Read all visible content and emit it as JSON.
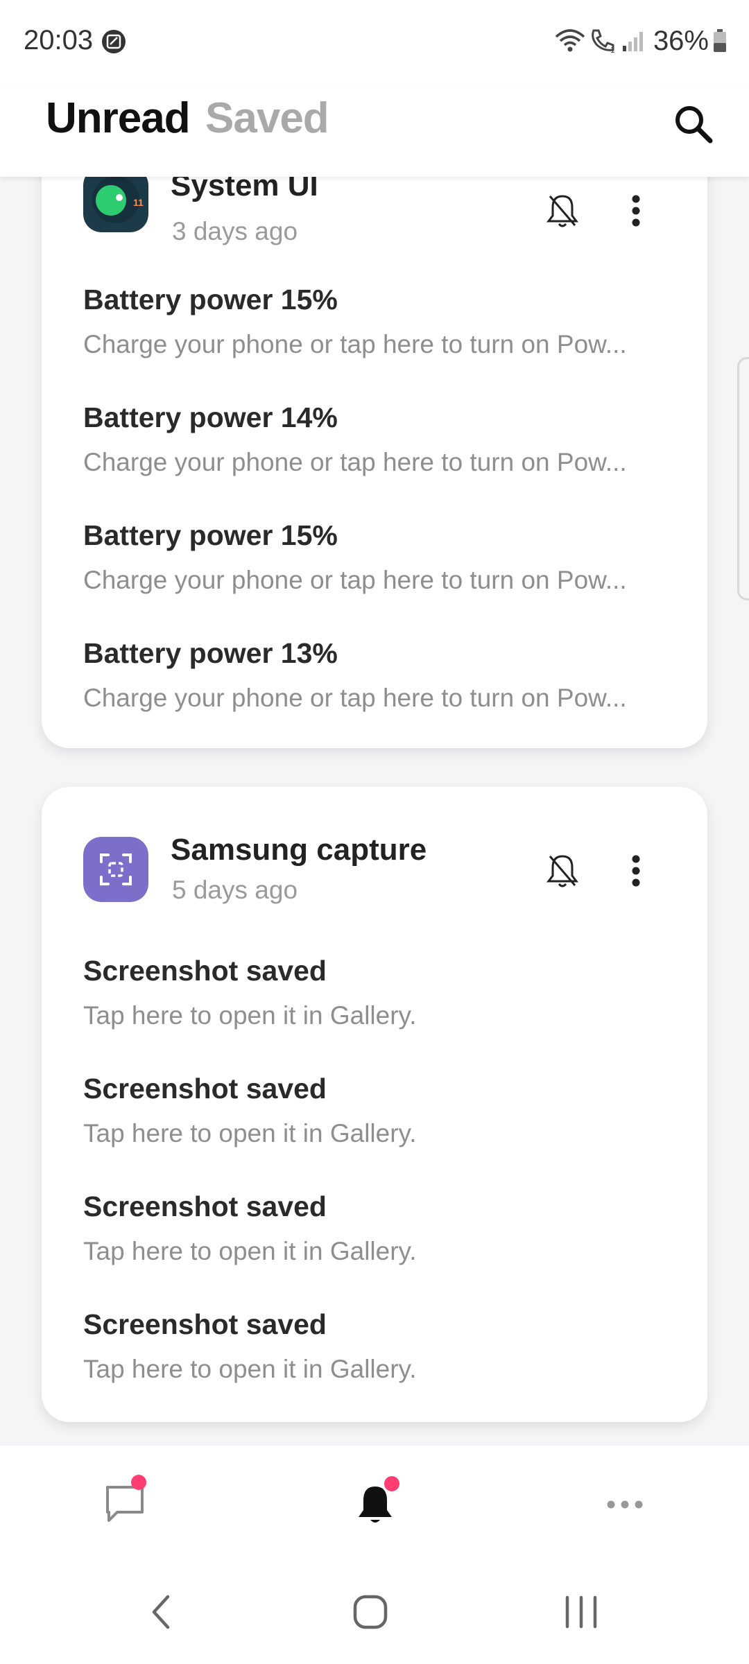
{
  "status_bar": {
    "time": "20:03",
    "battery": "36%",
    "icons": [
      "app-notification-icon",
      "wifi-icon",
      "call-icon",
      "signal-icon",
      "battery-icon"
    ]
  },
  "header": {
    "tabs": [
      {
        "label": "Unread",
        "active": true
      },
      {
        "label": "Saved",
        "active": false
      }
    ],
    "search_icon": "search-icon"
  },
  "cards": [
    {
      "app_name": "System UI",
      "time_ago": "3 days ago",
      "icon": "system-ui-icon",
      "icon_badge": "11",
      "notifications": [
        {
          "title": "Battery power 15%",
          "body": "Charge your phone or tap here to turn on Pow..."
        },
        {
          "title": "Battery power 14%",
          "body": "Charge your phone or tap here to turn on Pow..."
        },
        {
          "title": "Battery power 15%",
          "body": "Charge your phone or tap here to turn on Pow..."
        },
        {
          "title": "Battery power 13%",
          "body": "Charge your phone or tap here to turn on Pow..."
        }
      ]
    },
    {
      "app_name": "Samsung capture",
      "time_ago": "5 days ago",
      "icon": "samsung-capture-icon",
      "notifications": [
        {
          "title": "Screenshot saved",
          "body": "Tap here to open it in Gallery."
        },
        {
          "title": "Screenshot saved",
          "body": "Tap here to open it in Gallery."
        },
        {
          "title": "Screenshot saved",
          "body": "Tap here to open it in Gallery."
        },
        {
          "title": "Screenshot saved",
          "body": "Tap here to open it in Gallery."
        }
      ]
    }
  ],
  "bottom_nav": {
    "items": [
      "chat-icon",
      "bell-icon",
      "more-icon"
    ],
    "badge_color": "#ff3d71"
  },
  "system_nav": [
    "back-icon",
    "home-icon",
    "recents-icon"
  ],
  "colors": {
    "accent_badge": "#ff3d71",
    "capture_icon_bg": "#7b6fc9",
    "system_ui_icon_bg": "#1d3a49",
    "system_ui_dot": "#2ecc71"
  }
}
